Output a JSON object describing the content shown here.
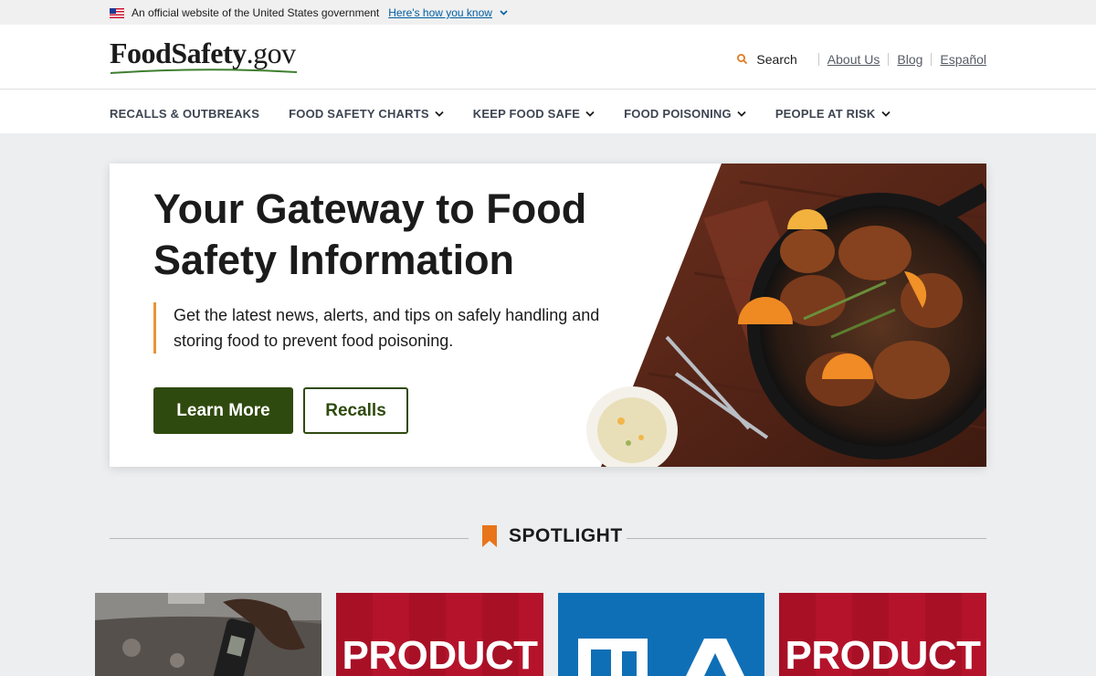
{
  "gov_banner": {
    "text": "An official website of the United States government",
    "link": "Here's how you know"
  },
  "header": {
    "logo_bold": "FoodSafety",
    "logo_light": ".gov",
    "search": "Search",
    "links": [
      "About Us",
      "Blog",
      "Español"
    ]
  },
  "nav": {
    "items": [
      "RECALLS & OUTBREAKS",
      "FOOD SAFETY CHARTS",
      "KEEP FOOD SAFE",
      "FOOD POISONING",
      "PEOPLE AT RISK"
    ]
  },
  "hero": {
    "title": "Your Gateway to Food Safety Information",
    "description": "Get the latest news, alerts, and tips on safely handling and storing food to prevent food poisoning.",
    "primary_button": "Learn More",
    "secondary_button": "Recalls"
  },
  "spotlight": {
    "heading": "SPOTLIGHT"
  },
  "cards": [
    {
      "word": ""
    },
    {
      "word": "PRODUCT"
    },
    {
      "word": ""
    },
    {
      "word": "PRODUCT"
    }
  ],
  "colors": {
    "primary_green": "#2f4a0e",
    "accent_orange": "#e89536",
    "page_bg": "#eceef0",
    "card_red": "#b5132b",
    "card_blue": "#0f6fb6"
  },
  "icons": [
    "us-flag-icon",
    "chevron-down-icon",
    "search-icon",
    "bookmark-icon"
  ]
}
